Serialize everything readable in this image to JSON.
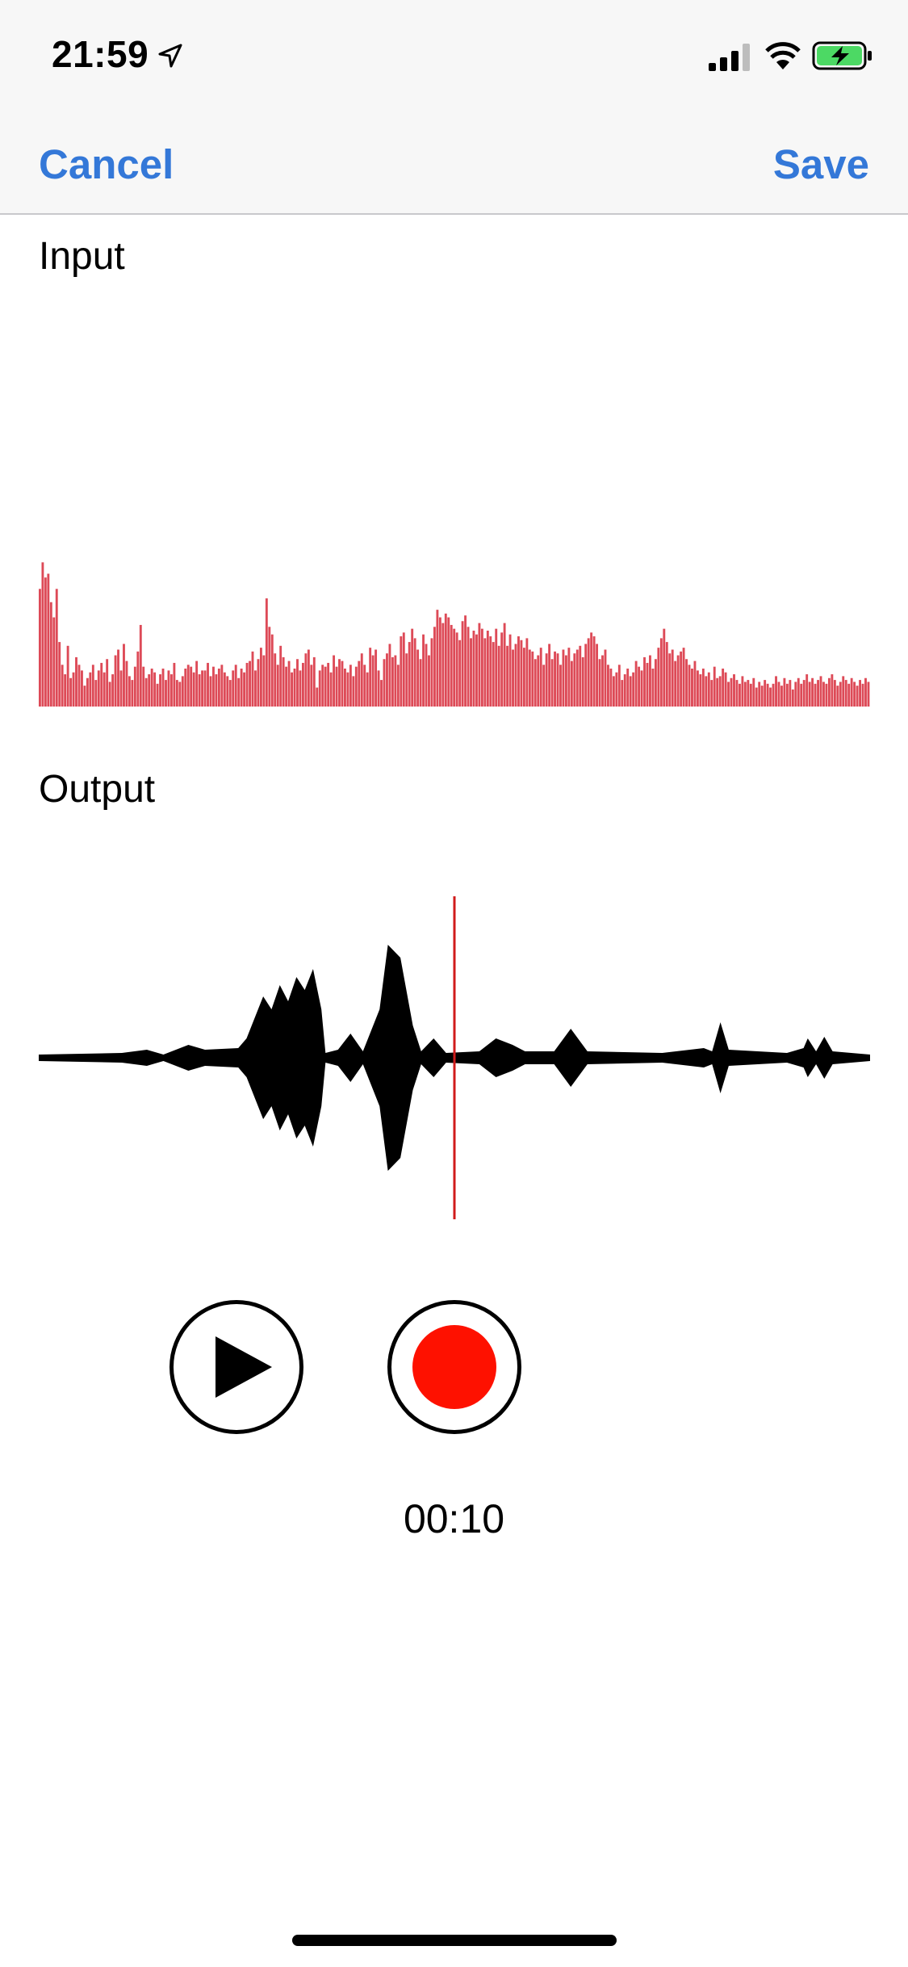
{
  "status_bar": {
    "time": "21:59"
  },
  "nav": {
    "cancel_label": "Cancel",
    "save_label": "Save"
  },
  "input": {
    "label": "Input",
    "bar_color": "#dd4a57",
    "levels": [
      0.62,
      0.76,
      0.68,
      0.7,
      0.55,
      0.47,
      0.62,
      0.34,
      0.22,
      0.17,
      0.32,
      0.15,
      0.18,
      0.26,
      0.22,
      0.19,
      0.11,
      0.15,
      0.18,
      0.22,
      0.14,
      0.19,
      0.23,
      0.18,
      0.25,
      0.13,
      0.17,
      0.27,
      0.3,
      0.19,
      0.33,
      0.24,
      0.16,
      0.14,
      0.21,
      0.29,
      0.43,
      0.21,
      0.15,
      0.17,
      0.2,
      0.18,
      0.12,
      0.17,
      0.2,
      0.14,
      0.19,
      0.17,
      0.23,
      0.14,
      0.13,
      0.16,
      0.2,
      0.22,
      0.21,
      0.18,
      0.24,
      0.17,
      0.19,
      0.19,
      0.23,
      0.16,
      0.21,
      0.17,
      0.2,
      0.22,
      0.18,
      0.16,
      0.14,
      0.19,
      0.22,
      0.15,
      0.2,
      0.18,
      0.23,
      0.24,
      0.29,
      0.19,
      0.25,
      0.31,
      0.27,
      0.57,
      0.42,
      0.38,
      0.28,
      0.22,
      0.32,
      0.26,
      0.21,
      0.24,
      0.18,
      0.2,
      0.25,
      0.19,
      0.23,
      0.28,
      0.3,
      0.22,
      0.26,
      0.1,
      0.19,
      0.22,
      0.21,
      0.23,
      0.18,
      0.27,
      0.21,
      0.25,
      0.24,
      0.2,
      0.18,
      0.22,
      0.16,
      0.21,
      0.24,
      0.28,
      0.22,
      0.18,
      0.31,
      0.27,
      0.3,
      0.19,
      0.14,
      0.25,
      0.28,
      0.33,
      0.26,
      0.27,
      0.22,
      0.37,
      0.39,
      0.28,
      0.34,
      0.41,
      0.36,
      0.3,
      0.25,
      0.38,
      0.33,
      0.27,
      0.36,
      0.42,
      0.51,
      0.47,
      0.44,
      0.49,
      0.47,
      0.43,
      0.41,
      0.39,
      0.35,
      0.45,
      0.48,
      0.42,
      0.36,
      0.4,
      0.38,
      0.44,
      0.41,
      0.36,
      0.4,
      0.37,
      0.34,
      0.41,
      0.32,
      0.39,
      0.44,
      0.32,
      0.38,
      0.3,
      0.33,
      0.37,
      0.35,
      0.31,
      0.36,
      0.3,
      0.29,
      0.25,
      0.27,
      0.31,
      0.22,
      0.28,
      0.33,
      0.25,
      0.29,
      0.28,
      0.22,
      0.3,
      0.27,
      0.31,
      0.24,
      0.28,
      0.3,
      0.32,
      0.26,
      0.33,
      0.36,
      0.39,
      0.37,
      0.33,
      0.25,
      0.27,
      0.3,
      0.22,
      0.2,
      0.16,
      0.18,
      0.22,
      0.14,
      0.17,
      0.2,
      0.16,
      0.18,
      0.24,
      0.21,
      0.19,
      0.26,
      0.23,
      0.27,
      0.2,
      0.25,
      0.31,
      0.36,
      0.41,
      0.34,
      0.28,
      0.3,
      0.24,
      0.27,
      0.29,
      0.31,
      0.25,
      0.22,
      0.2,
      0.24,
      0.19,
      0.17,
      0.2,
      0.16,
      0.18,
      0.14,
      0.21,
      0.15,
      0.16,
      0.2,
      0.18,
      0.13,
      0.15,
      0.17,
      0.14,
      0.12,
      0.16,
      0.13,
      0.14,
      0.12,
      0.15,
      0.1,
      0.13,
      0.11,
      0.14,
      0.12,
      0.1,
      0.12,
      0.16,
      0.13,
      0.11,
      0.15,
      0.12,
      0.14,
      0.09,
      0.13,
      0.15,
      0.12,
      0.14,
      0.17,
      0.13,
      0.15,
      0.12,
      0.14,
      0.16,
      0.13,
      0.12,
      0.15,
      0.17,
      0.14,
      0.11,
      0.13,
      0.16,
      0.14,
      0.12,
      0.15,
      0.13,
      0.11,
      0.14,
      0.12,
      0.15,
      0.13
    ]
  },
  "output": {
    "label": "Output",
    "waveform_color": "#000000",
    "playhead_color": "#d01b1b",
    "playhead_position": 0.5,
    "envelope": [
      {
        "at": 0.0,
        "amp": 0.02
      },
      {
        "at": 0.1,
        "amp": 0.03
      },
      {
        "at": 0.13,
        "amp": 0.05
      },
      {
        "at": 0.15,
        "amp": 0.02
      },
      {
        "at": 0.18,
        "amp": 0.08
      },
      {
        "at": 0.2,
        "amp": 0.05
      },
      {
        "at": 0.24,
        "amp": 0.06
      },
      {
        "at": 0.25,
        "amp": 0.12
      },
      {
        "at": 0.27,
        "amp": 0.38
      },
      {
        "at": 0.28,
        "amp": 0.3
      },
      {
        "at": 0.29,
        "amp": 0.45
      },
      {
        "at": 0.3,
        "amp": 0.35
      },
      {
        "at": 0.31,
        "amp": 0.5
      },
      {
        "at": 0.32,
        "amp": 0.42
      },
      {
        "at": 0.33,
        "amp": 0.55
      },
      {
        "at": 0.34,
        "amp": 0.3
      },
      {
        "at": 0.345,
        "amp": 0.03
      },
      {
        "at": 0.36,
        "amp": 0.05
      },
      {
        "at": 0.375,
        "amp": 0.15
      },
      {
        "at": 0.39,
        "amp": 0.04
      },
      {
        "at": 0.41,
        "amp": 0.3
      },
      {
        "at": 0.42,
        "amp": 0.7
      },
      {
        "at": 0.435,
        "amp": 0.62
      },
      {
        "at": 0.45,
        "amp": 0.2
      },
      {
        "at": 0.46,
        "amp": 0.04
      },
      {
        "at": 0.475,
        "amp": 0.12
      },
      {
        "at": 0.49,
        "amp": 0.03
      },
      {
        "at": 0.53,
        "amp": 0.04
      },
      {
        "at": 0.55,
        "amp": 0.12
      },
      {
        "at": 0.57,
        "amp": 0.08
      },
      {
        "at": 0.585,
        "amp": 0.04
      },
      {
        "at": 0.62,
        "amp": 0.04
      },
      {
        "at": 0.64,
        "amp": 0.18
      },
      {
        "at": 0.66,
        "amp": 0.04
      },
      {
        "at": 0.75,
        "amp": 0.03
      },
      {
        "at": 0.8,
        "amp": 0.06
      },
      {
        "at": 0.81,
        "amp": 0.04
      },
      {
        "at": 0.82,
        "amp": 0.22
      },
      {
        "at": 0.83,
        "amp": 0.05
      },
      {
        "at": 0.9,
        "amp": 0.03
      },
      {
        "at": 0.92,
        "amp": 0.06
      },
      {
        "at": 0.925,
        "amp": 0.12
      },
      {
        "at": 0.935,
        "amp": 0.04
      },
      {
        "at": 0.945,
        "amp": 0.13
      },
      {
        "at": 0.955,
        "amp": 0.04
      },
      {
        "at": 1.0,
        "amp": 0.02
      }
    ]
  },
  "controls": {
    "elapsed": "00:10",
    "record_color": "#fe1100"
  }
}
